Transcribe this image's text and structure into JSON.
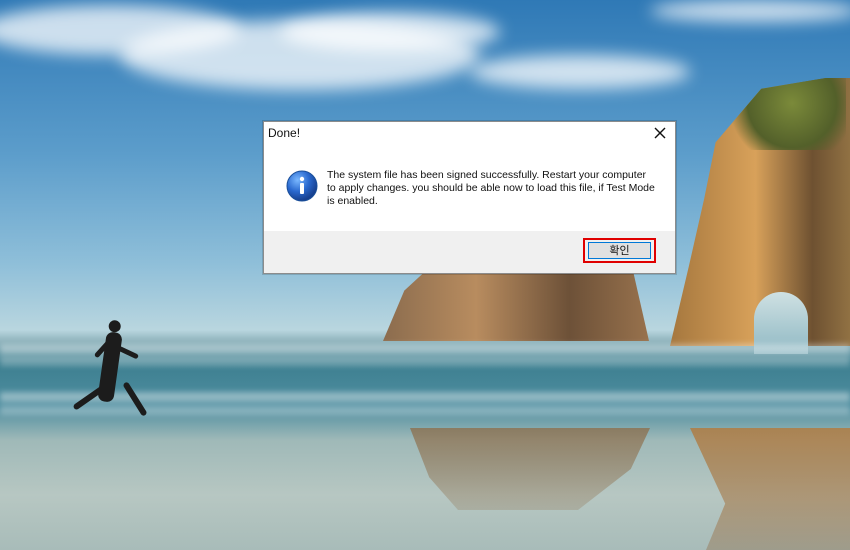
{
  "desktop": {
    "wallpaper": "beach-runner-wallpaper"
  },
  "dialog": {
    "title": "Done!",
    "message": "The system file has been signed successfully. Restart your computer to apply changes. you should be able now to load this file, if Test Mode is enabled.",
    "icon": "info-icon",
    "ok_label": "확인",
    "close_icon": "close-icon",
    "accent_color": "#0078d7",
    "highlight_color": "#e00000"
  }
}
